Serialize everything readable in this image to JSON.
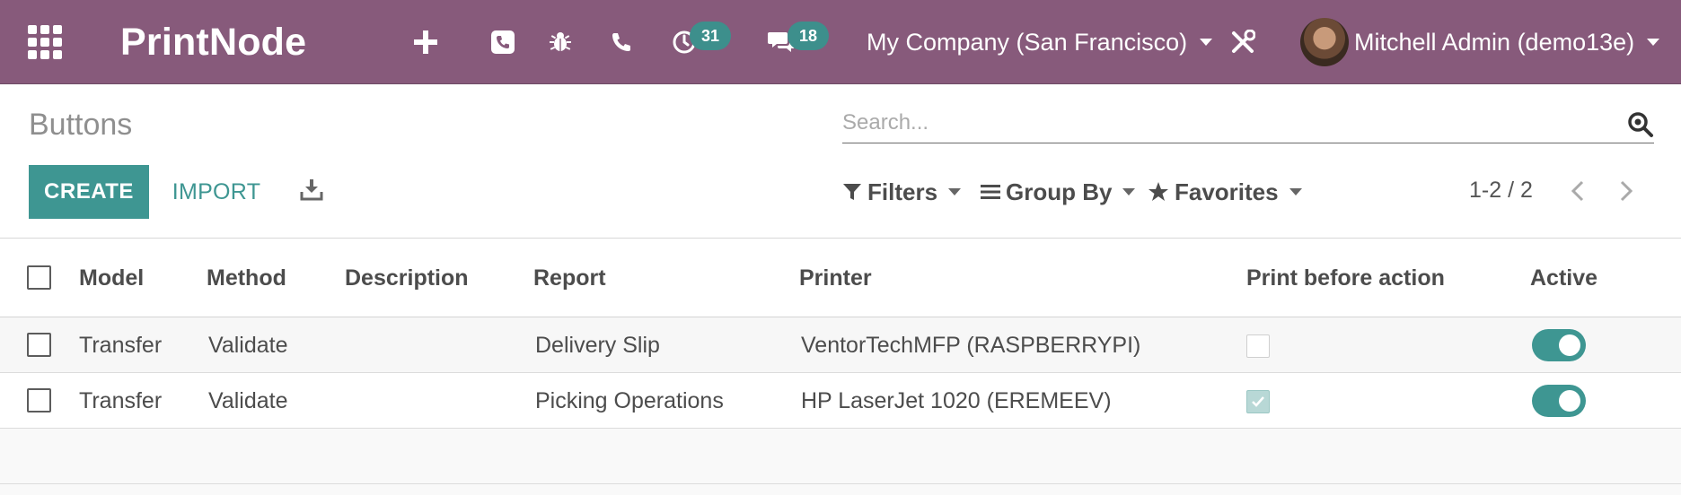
{
  "navbar": {
    "app_title": "PrintNode",
    "activity_count": "31",
    "messages_count": "18",
    "company": "My Company (San Francisco)",
    "user": "Mitchell Admin (demo13e)"
  },
  "control_panel": {
    "breadcrumb": "Buttons",
    "search_placeholder": "Search...",
    "create_label": "CREATE",
    "import_label": "IMPORT",
    "filters_label": "Filters",
    "group_by_label": "Group By",
    "favorites_label": "Favorites",
    "pager": "1-2 / 2"
  },
  "table": {
    "columns": [
      "Model",
      "Method",
      "Description",
      "Report",
      "Printer",
      "Print before action",
      "Active"
    ],
    "rows": [
      {
        "model": "Transfer",
        "method": "Validate",
        "description": "",
        "report": "Delivery Slip",
        "printer": "VentorTechMFP (RASPBERRYPI)",
        "print_before_action": false,
        "active": true
      },
      {
        "model": "Transfer",
        "method": "Validate",
        "description": "",
        "report": "Picking Operations",
        "printer": "HP LaserJet 1020 (EREMEEV)",
        "print_before_action": true,
        "active": true
      }
    ]
  },
  "colors": {
    "navbar": "#875a7b",
    "accent": "#3e9692"
  },
  "icons": {
    "apps": "grid-icon",
    "quick_create": "plus-icon",
    "voip": "phone-square-icon",
    "debug": "bug-icon",
    "phone": "phone-icon",
    "activity": "clock-icon",
    "messages": "comments-icon",
    "settings": "tools-icon",
    "search": "search-icon",
    "download": "download-icon",
    "filter": "filter-icon",
    "group_by": "bars-icon",
    "favorites": "star-icon",
    "pager_prev": "chevron-left-icon",
    "pager_next": "chevron-right-icon"
  }
}
